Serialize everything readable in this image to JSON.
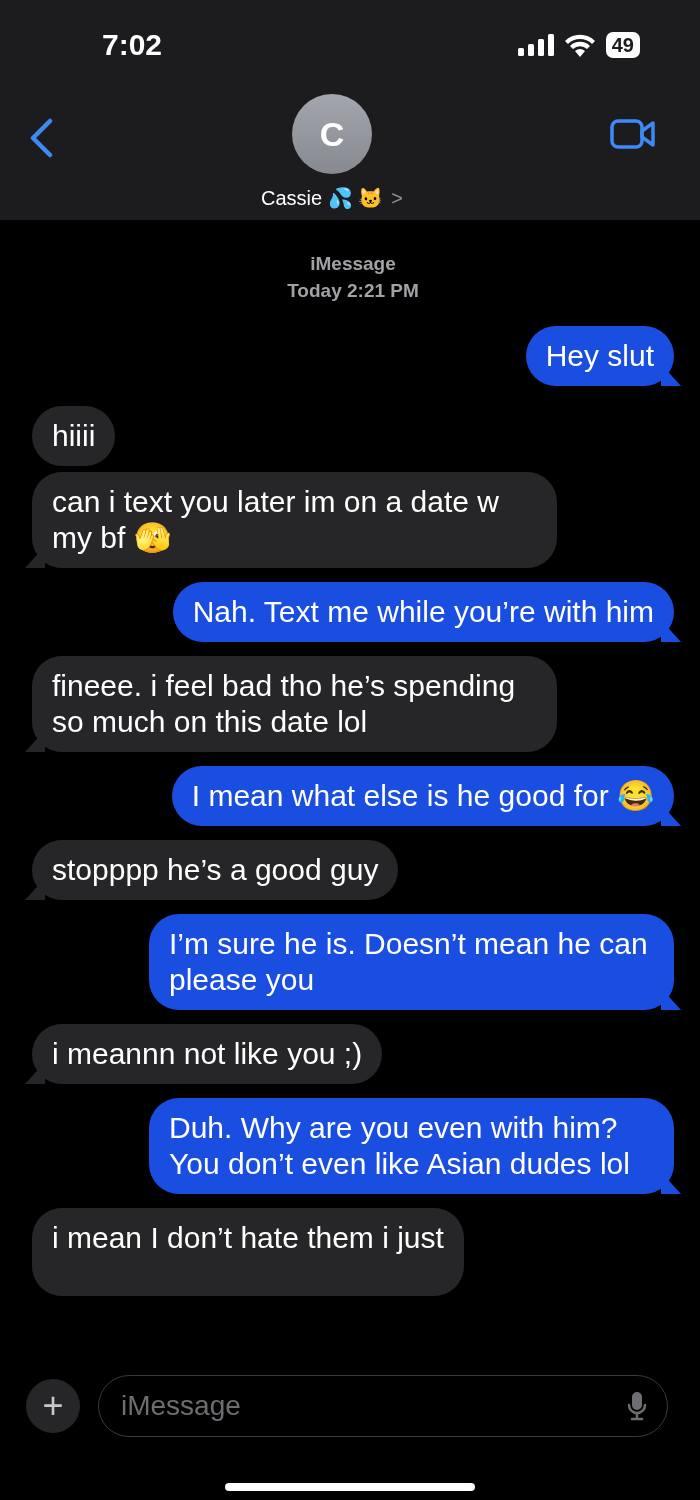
{
  "status_bar": {
    "time": "7:02",
    "battery": "49"
  },
  "header": {
    "avatar_initial": "C",
    "contact_name": "Cassie 💦 🐱",
    "chevron": ">"
  },
  "thread_info": {
    "service": "iMessage",
    "timestamp": "Today 2:21 PM"
  },
  "messages": [
    {
      "kind": "sent",
      "text": "Hey slut"
    },
    {
      "kind": "received",
      "text": "hiiii"
    },
    {
      "kind": "received",
      "text": "can i text you later im on a date w my bf 🫣"
    },
    {
      "kind": "sent",
      "text": "Nah. Text me while you’re with him"
    },
    {
      "kind": "received",
      "text": "fineee. i feel bad tho he’s spending so much on this date lol"
    },
    {
      "kind": "sent",
      "text": "I mean what else is he good for 😂"
    },
    {
      "kind": "received",
      "text": "stopppp he’s a good guy"
    },
    {
      "kind": "sent",
      "text": "I’m sure he is. Doesn’t mean he can please you"
    },
    {
      "kind": "received",
      "text": "i meannn not like you ;)"
    },
    {
      "kind": "sent",
      "text": "Duh. Why are you even with him? You don’t even like Asian dudes lol"
    },
    {
      "kind": "received",
      "text": "i mean I don’t hate them i just"
    }
  ],
  "composer": {
    "plus": "+",
    "placeholder": "iMessage"
  }
}
